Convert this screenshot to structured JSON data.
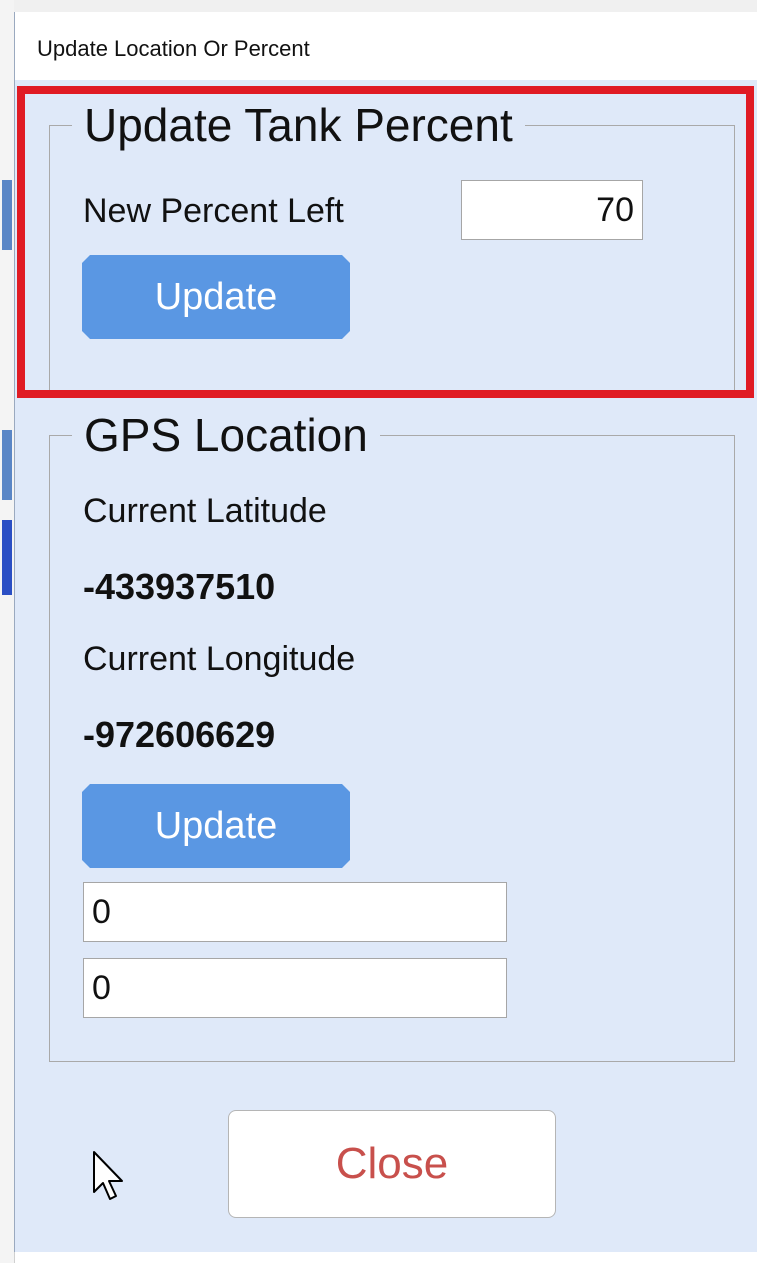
{
  "window": {
    "title": "Update Location Or Percent"
  },
  "tank_group": {
    "legend": "Update Tank Percent",
    "percent_label": "New Percent Left",
    "percent_value": "70",
    "update_label": "Update"
  },
  "gps_group": {
    "legend": "GPS Location",
    "latitude_label": "Current Latitude",
    "latitude_value": "-433937510",
    "longitude_label": "Current Longitude",
    "longitude_value": "-972606629",
    "update_label": "Update",
    "input_1_value": "0",
    "input_2_value": "0"
  },
  "close_label": "Close",
  "colors": {
    "dialog_bg": "#dfe9f9",
    "button_blue": "#5a97e3",
    "highlight_red": "#e01b24",
    "close_text": "#c8504c"
  },
  "icons": {
    "cursor": "mouse-pointer-icon"
  }
}
